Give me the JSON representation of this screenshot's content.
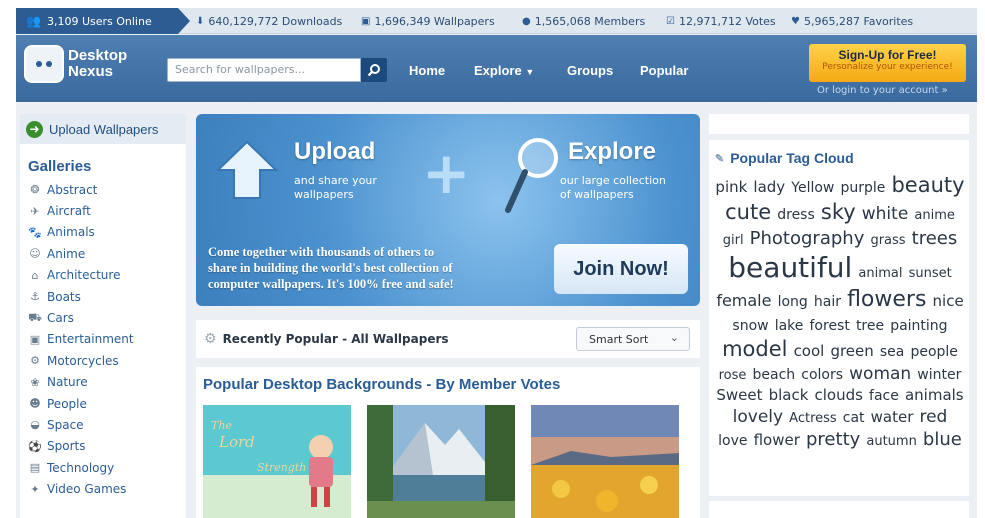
{
  "stats": {
    "online": "3,109 Users Online",
    "downloads": "640,129,772 Downloads",
    "wallpapers": "1,696,349 Wallpapers",
    "members": "1,565,068 Members",
    "votes": "12,971,712 Votes",
    "favorites": "5,965,287 Favorites"
  },
  "logo": {
    "line1": "Desktop",
    "line2": "Nexus"
  },
  "search": {
    "placeholder": "Search for wallpapers..."
  },
  "nav": {
    "home": "Home",
    "explore": "Explore",
    "groups": "Groups",
    "popular": "Popular"
  },
  "signup": {
    "title": "Sign-Up for Free!",
    "subtitle": "Personalize your experience!",
    "login": "Or login to your account »"
  },
  "sidebar": {
    "upload": "Upload Wallpapers",
    "galleries_title": "Galleries",
    "items": [
      {
        "label": "Abstract",
        "icon": "abstract-icon",
        "glyph": "❂"
      },
      {
        "label": "Aircraft",
        "icon": "aircraft-icon",
        "glyph": "✈"
      },
      {
        "label": "Animals",
        "icon": "animals-icon",
        "glyph": "🐾"
      },
      {
        "label": "Anime",
        "icon": "anime-icon",
        "glyph": "☺"
      },
      {
        "label": "Architecture",
        "icon": "architecture-icon",
        "glyph": "⌂"
      },
      {
        "label": "Boats",
        "icon": "boats-icon",
        "glyph": "⚓"
      },
      {
        "label": "Cars",
        "icon": "cars-icon",
        "glyph": "⛟"
      },
      {
        "label": "Entertainment",
        "icon": "entertainment-icon",
        "glyph": "▣"
      },
      {
        "label": "Motorcycles",
        "icon": "motorcycles-icon",
        "glyph": "⚙"
      },
      {
        "label": "Nature",
        "icon": "nature-icon",
        "glyph": "❀"
      },
      {
        "label": "People",
        "icon": "people-icon",
        "glyph": "☻"
      },
      {
        "label": "Space",
        "icon": "space-icon",
        "glyph": "◒"
      },
      {
        "label": "Sports",
        "icon": "sports-icon",
        "glyph": "⚽"
      },
      {
        "label": "Technology",
        "icon": "technology-icon",
        "glyph": "▤"
      },
      {
        "label": "Video Games",
        "icon": "video-games-icon",
        "glyph": "✦"
      }
    ]
  },
  "banner": {
    "upload_title": "Upload",
    "upload_sub1": "and share your",
    "upload_sub2": "wallpapers",
    "explore_title": "Explore",
    "explore_sub1": "our large collection",
    "explore_sub2": "of wallpapers",
    "desc1": "Come together with thousands of others to",
    "desc2": "share in building the world's best collection of",
    "desc3": "computer wallpapers. It's 100% free and safe!",
    "join": "Join Now!"
  },
  "recent": {
    "title": "Recently Popular - All Wallpapers",
    "sort": "Smart Sort"
  },
  "popular": {
    "title": "Popular Desktop Backgrounds - By Member Votes"
  },
  "tagcloud": {
    "title": "Popular Tag Cloud",
    "tags": [
      {
        "t": "pink",
        "s": 15
      },
      {
        "t": "lady",
        "s": 15
      },
      {
        "t": "Yellow",
        "s": 14
      },
      {
        "t": "purple",
        "s": 14
      },
      {
        "t": "beauty",
        "s": 21
      },
      {
        "t": "cute",
        "s": 21
      },
      {
        "t": "dress",
        "s": 14
      },
      {
        "t": "sky",
        "s": 21
      },
      {
        "t": "white",
        "s": 17
      },
      {
        "t": "anime",
        "s": 13
      },
      {
        "t": "girl",
        "s": 13
      },
      {
        "t": "Photography",
        "s": 18
      },
      {
        "t": "grass",
        "s": 13
      },
      {
        "t": "trees",
        "s": 18
      },
      {
        "t": "beautiful",
        "s": 28
      },
      {
        "t": "animal",
        "s": 13
      },
      {
        "t": "sunset",
        "s": 13
      },
      {
        "t": "female",
        "s": 16
      },
      {
        "t": "long",
        "s": 14
      },
      {
        "t": "hair",
        "s": 14
      },
      {
        "t": "flowers",
        "s": 22
      },
      {
        "t": "nice",
        "s": 15
      },
      {
        "t": "snow",
        "s": 14
      },
      {
        "t": "lake",
        "s": 14
      },
      {
        "t": "forest",
        "s": 14
      },
      {
        "t": "tree",
        "s": 14
      },
      {
        "t": "painting",
        "s": 14
      },
      {
        "t": "model",
        "s": 21
      },
      {
        "t": "cool",
        "s": 15
      },
      {
        "t": "green",
        "s": 15
      },
      {
        "t": "sea",
        "s": 14
      },
      {
        "t": "people",
        "s": 14
      },
      {
        "t": "rose",
        "s": 13
      },
      {
        "t": "beach",
        "s": 14
      },
      {
        "t": "colors",
        "s": 14
      },
      {
        "t": "woman",
        "s": 17
      },
      {
        "t": "winter",
        "s": 14
      },
      {
        "t": "Sweet",
        "s": 15
      },
      {
        "t": "black",
        "s": 15
      },
      {
        "t": "clouds",
        "s": 15
      },
      {
        "t": "face",
        "s": 14
      },
      {
        "t": "animals",
        "s": 15
      },
      {
        "t": "lovely",
        "s": 17
      },
      {
        "t": "Actress",
        "s": 13
      },
      {
        "t": "cat",
        "s": 14
      },
      {
        "t": "water",
        "s": 15
      },
      {
        "t": "red",
        "s": 17
      },
      {
        "t": "love",
        "s": 14
      },
      {
        "t": "flower",
        "s": 15
      },
      {
        "t": "pretty",
        "s": 18
      },
      {
        "t": "autumn",
        "s": 13
      },
      {
        "t": "blue",
        "s": 18
      }
    ]
  },
  "colors": {
    "brand": "#2c5c91",
    "link": "#2a5d96",
    "header": "#3a6a9e",
    "signup": "#f5a914"
  }
}
